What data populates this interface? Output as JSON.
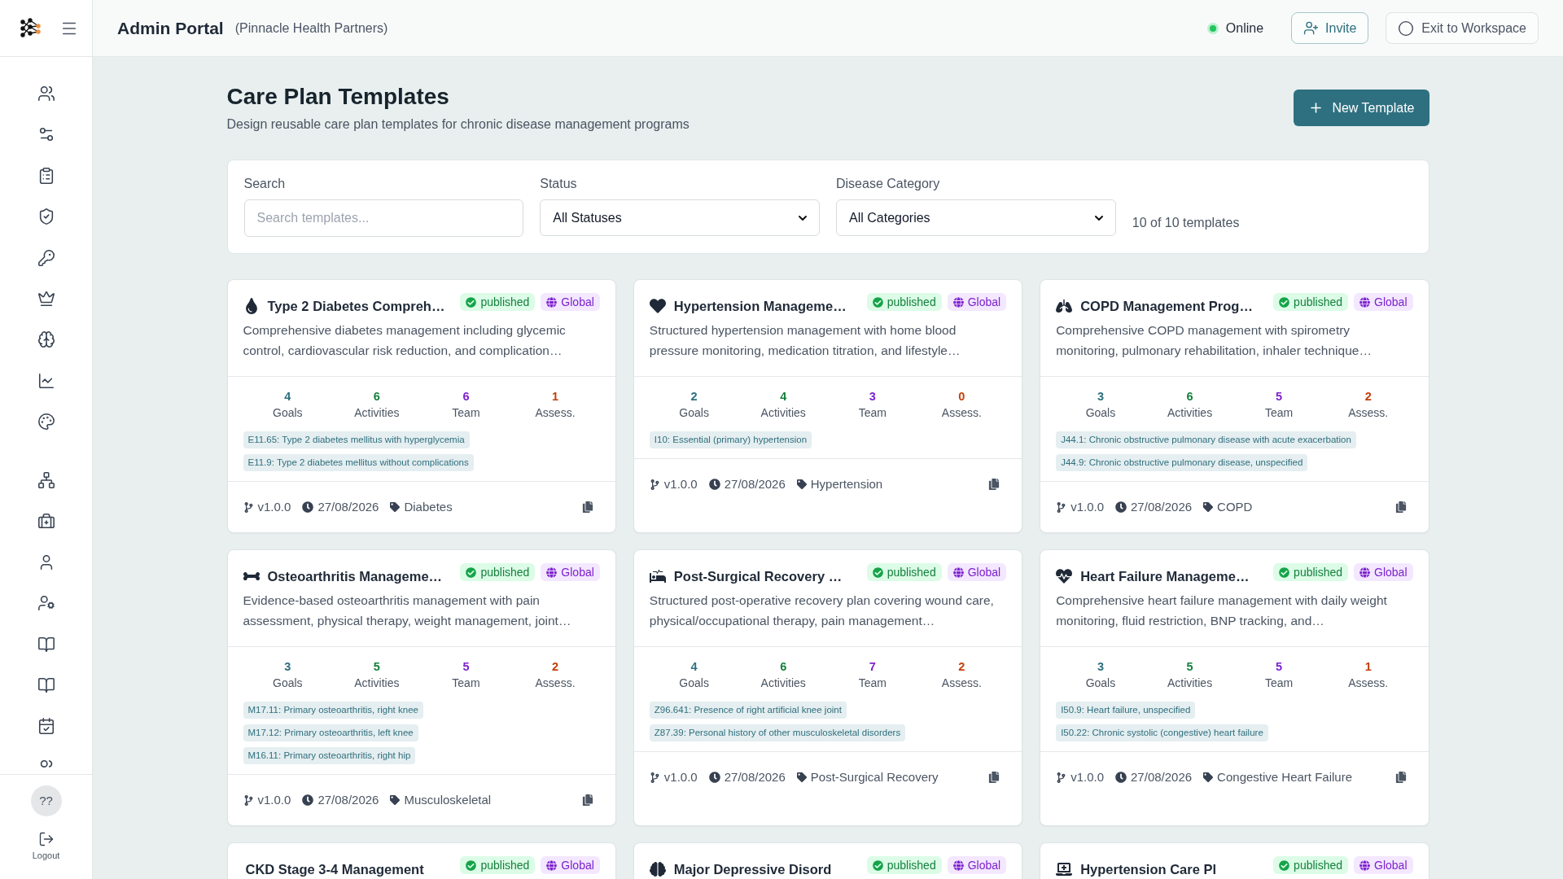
{
  "header": {
    "title": "Admin Portal",
    "organization": "(Pinnacle Health Partners)",
    "status": {
      "label": "Online",
      "online": true
    },
    "buttons": [
      {
        "label": "Invite",
        "kind": "invite"
      },
      {
        "label": "Exit to Workspace",
        "kind": "exit"
      }
    ]
  },
  "sidebar": {
    "avatar": "??",
    "logout": "Logout"
  },
  "page": {
    "title": "Care Plan Templates",
    "subtitle": "Design reusable care plan templates for chronic disease management programs",
    "new_button": "New Template"
  },
  "filters": {
    "search": {
      "label": "Search",
      "placeholder": "Search templates..."
    },
    "status": {
      "label": "Status",
      "value": "All Statuses"
    },
    "category": {
      "label": "Disease Category",
      "value": "All Categories"
    },
    "count": "10 of 10 templates"
  },
  "templates": [
    {
      "title": "Type 2 Diabetes Compreh…",
      "status": "published",
      "scope": "Global",
      "description": "Comprehensive diabetes management including glycemic control, cardiovascular risk reduction, and complication…",
      "stats": [
        {
          "value": "4",
          "label": "Goals",
          "color": "#2e7080"
        },
        {
          "value": "6",
          "label": "Activities",
          "color": "#15803d"
        },
        {
          "value": "6",
          "label": "Team",
          "color": "#7e22ce"
        },
        {
          "value": "1",
          "label": "Assess.",
          "color": "#c2410c"
        }
      ],
      "codes": [
        "E11.65: Type 2 diabetes mellitus with hyperglycemia",
        "E11.9: Type 2 diabetes mellitus without complications"
      ],
      "version": "v1.0.0",
      "date": "27/08/2026",
      "category": "Diabetes"
    },
    {
      "title": "Hypertension Manageme…",
      "status": "published",
      "scope": "Global",
      "description": "Structured hypertension management with home blood pressure monitoring, medication titration, and lifestyle…",
      "stats": [
        {
          "value": "2",
          "label": "Goals",
          "color": "#2e7080"
        },
        {
          "value": "4",
          "label": "Activities",
          "color": "#15803d"
        },
        {
          "value": "3",
          "label": "Team",
          "color": "#7e22ce"
        },
        {
          "value": "0",
          "label": "Assess.",
          "color": "#c2410c"
        }
      ],
      "codes": [
        "I10: Essential (primary) hypertension"
      ],
      "version": "v1.0.0",
      "date": "27/08/2026",
      "category": "Hypertension"
    },
    {
      "title": "COPD Management Prog…",
      "status": "published",
      "scope": "Global",
      "description": "Comprehensive COPD management with spirometry monitoring, pulmonary rehabilitation, inhaler technique…",
      "stats": [
        {
          "value": "3",
          "label": "Goals",
          "color": "#2e7080"
        },
        {
          "value": "6",
          "label": "Activities",
          "color": "#15803d"
        },
        {
          "value": "5",
          "label": "Team",
          "color": "#7e22ce"
        },
        {
          "value": "2",
          "label": "Assess.",
          "color": "#c2410c"
        }
      ],
      "codes": [
        "J44.1: Chronic obstructive pulmonary disease with acute exacerbation",
        "J44.9: Chronic obstructive pulmonary disease, unspecified"
      ],
      "version": "v1.0.0",
      "date": "27/08/2026",
      "category": "COPD"
    },
    {
      "title": "Osteoarthritis Manageme…",
      "status": "published",
      "scope": "Global",
      "description": "Evidence-based osteoarthritis management with pain assessment, physical therapy, weight management, joint…",
      "stats": [
        {
          "value": "3",
          "label": "Goals",
          "color": "#2e7080"
        },
        {
          "value": "5",
          "label": "Activities",
          "color": "#15803d"
        },
        {
          "value": "5",
          "label": "Team",
          "color": "#7e22ce"
        },
        {
          "value": "2",
          "label": "Assess.",
          "color": "#c2410c"
        }
      ],
      "codes": [
        "M17.11: Primary osteoarthritis, right knee",
        "M17.12: Primary osteoarthritis, left knee",
        "M16.11: Primary osteoarthritis, right hip"
      ],
      "version": "v1.0.0",
      "date": "27/08/2026",
      "category": "Musculoskeletal"
    },
    {
      "title": "Post-Surgical Recovery …",
      "status": "published",
      "scope": "Global",
      "description": "Structured post-operative recovery plan covering wound care, physical/occupational therapy, pain management…",
      "stats": [
        {
          "value": "4",
          "label": "Goals",
          "color": "#2e7080"
        },
        {
          "value": "6",
          "label": "Activities",
          "color": "#15803d"
        },
        {
          "value": "7",
          "label": "Team",
          "color": "#7e22ce"
        },
        {
          "value": "2",
          "label": "Assess.",
          "color": "#c2410c"
        }
      ],
      "codes": [
        "Z96.641: Presence of right artificial knee joint",
        "Z87.39: Personal history of other musculoskeletal disorders"
      ],
      "version": "v1.0.0",
      "date": "27/08/2026",
      "category": "Post-Surgical Recovery"
    },
    {
      "title": "Heart Failure Manageme…",
      "status": "published",
      "scope": "Global",
      "description": "Comprehensive heart failure management with daily weight monitoring, fluid restriction, BNP tracking, and…",
      "stats": [
        {
          "value": "3",
          "label": "Goals",
          "color": "#2e7080"
        },
        {
          "value": "5",
          "label": "Activities",
          "color": "#15803d"
        },
        {
          "value": "5",
          "label": "Team",
          "color": "#7e22ce"
        },
        {
          "value": "1",
          "label": "Assess.",
          "color": "#c2410c"
        }
      ],
      "codes": [
        "I50.9: Heart failure, unspecified",
        "I50.22: Chronic systolic (congestive) heart failure"
      ],
      "version": "v1.0.0",
      "date": "27/08/2026",
      "category": "Congestive Heart Failure"
    },
    {
      "title": "CKD Stage 3-4 Management",
      "status": "published",
      "scope": "Global"
    },
    {
      "title": "Major Depressive Disord",
      "status": "published",
      "scope": "Global"
    },
    {
      "title": "Hypertension Care Pl",
      "status": "published",
      "scope": "Global"
    }
  ]
}
